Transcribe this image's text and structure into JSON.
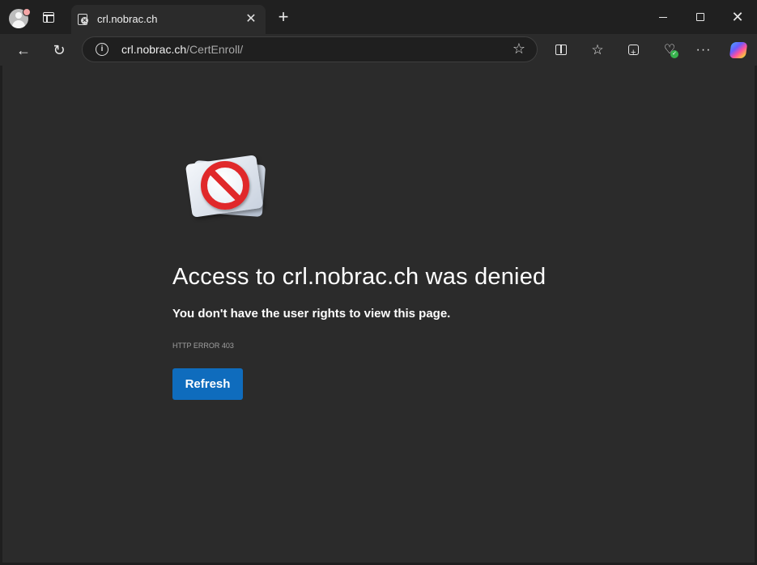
{
  "tab": {
    "title": "crl.nobrac.ch"
  },
  "address_bar": {
    "host": "crl.nobrac.ch",
    "path": "/CertEnroll/"
  },
  "error_page": {
    "title": "Access to crl.nobrac.ch was denied",
    "subtitle": "You don't have the user rights to view this page.",
    "error_code": "HTTP ERROR 403",
    "refresh_label": "Refresh"
  },
  "icons": {
    "profile": "profile-avatar-icon",
    "tab_actions": "tab-actions-icon",
    "favicon": "page-error-favicon-icon",
    "back": "back-arrow-icon",
    "reload": "reload-icon",
    "site_info": "info-icon",
    "favorite": "star-icon",
    "split_screen": "split-screen-icon",
    "favorites": "favorites-icon",
    "collections": "collections-icon",
    "browser_essentials": "heart-pulse-icon",
    "more": "ellipsis-icon",
    "copilot": "copilot-icon",
    "error_illustration": "no-entry-icon"
  },
  "colors": {
    "refresh_button": "#0f6cbd",
    "page_background": "#2b2b2b",
    "frame_background": "#202020",
    "no_sign": "#e0282a"
  }
}
